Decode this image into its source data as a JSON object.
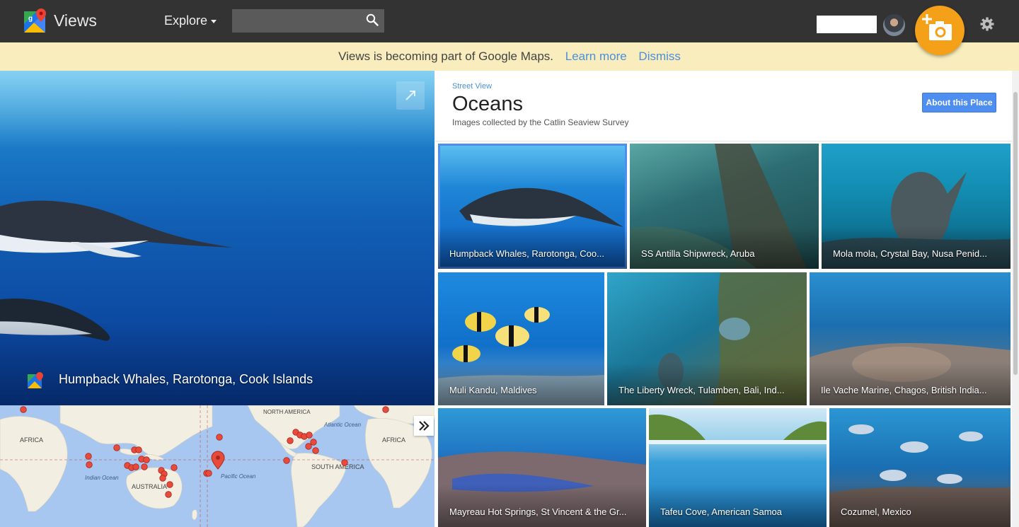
{
  "header": {
    "logo_text": "Views",
    "explore_label": "Explore",
    "search_value": "",
    "search_placeholder": ""
  },
  "banner": {
    "message": "Views is becoming part of Google Maps.",
    "learn_more": "Learn more",
    "dismiss": "Dismiss"
  },
  "hero": {
    "caption": "Humpback Whales, Rarotonga, Cook Islands"
  },
  "map": {
    "labels": [
      "NORTH AMERICA",
      "Atlantic Ocean",
      "AFRICA",
      "Indian Ocean",
      "AUSTRALIA",
      "Pacific Ocean",
      "SOUTH AMERICA",
      "AFRICA"
    ]
  },
  "place": {
    "breadcrumb": "Street View",
    "title": "Oceans",
    "subtitle": "Images collected by the Catlin Seaview Survey",
    "about_button": "About this Place"
  },
  "tiles": [
    {
      "caption": "Humpback Whales, Rarotonga, Coo..."
    },
    {
      "caption": "SS Antilla Shipwreck, Aruba"
    },
    {
      "caption": "Mola mola, Crystal Bay, Nusa Penid..."
    },
    {
      "caption": "Muli Kandu, Maldives"
    },
    {
      "caption": "The Liberty Wreck, Tulamben, Bali, Ind..."
    },
    {
      "caption": "Ile Vache Marine, Chagos, British India..."
    },
    {
      "caption": "Mayreau Hot Springs, St Vincent & the Gr..."
    },
    {
      "caption": "Tafeu Cove, American Samoa"
    },
    {
      "caption": "Cozumel, Mexico"
    }
  ],
  "colors": {
    "topbar": "#333333",
    "banner": "#f9edbd",
    "accent": "#4d8ef0",
    "camera": "#f4a019",
    "map_water": "#a7c6f0",
    "map_land": "#f2efe2",
    "map_pin": "#e84b3c"
  },
  "icons": [
    "google-maps-logo-icon",
    "search-icon",
    "add-photo-camera-icon",
    "gear-icon",
    "expand-icon",
    "double-chevron-right-icon",
    "map-pin-icon"
  ]
}
